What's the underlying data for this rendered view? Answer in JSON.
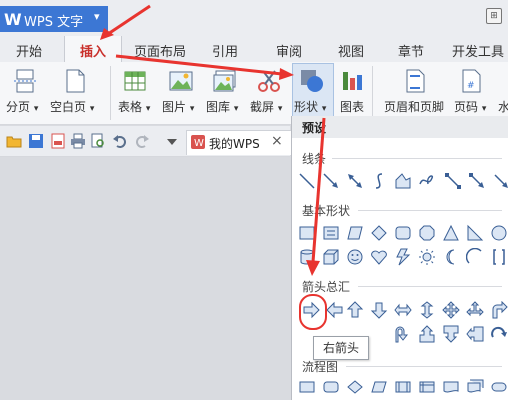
{
  "app": {
    "logo": "W",
    "title": "WPS 文字",
    "caret": "▾",
    "corner_icon": "⊞"
  },
  "menu_tabs": [
    "开始",
    "插入",
    "页面布局",
    "引用",
    "审阅",
    "视图",
    "章节",
    "开发工具"
  ],
  "toolbar": {
    "page_break": "分页",
    "blank_page": "空白页",
    "table": "表格",
    "picture": "图片",
    "gallery": "图库",
    "screenshot": "截屏",
    "shape": "形状",
    "chart": "图表",
    "header_footer": "页眉和页脚",
    "page_number": "页码",
    "watermark": "水",
    "dropdown_caret": "▾"
  },
  "quick_bar": {
    "doc_tab_label": "我的WPS",
    "close": "×"
  },
  "dropdown": {
    "preset": "预设",
    "lines": "线条",
    "basic_shapes": "基本形状",
    "block_arrows": "箭头总汇",
    "flowchart": "流程图"
  },
  "tooltip": "右箭头",
  "colors": {
    "accent": "#3c77d4",
    "annotation": "#e8342f"
  }
}
